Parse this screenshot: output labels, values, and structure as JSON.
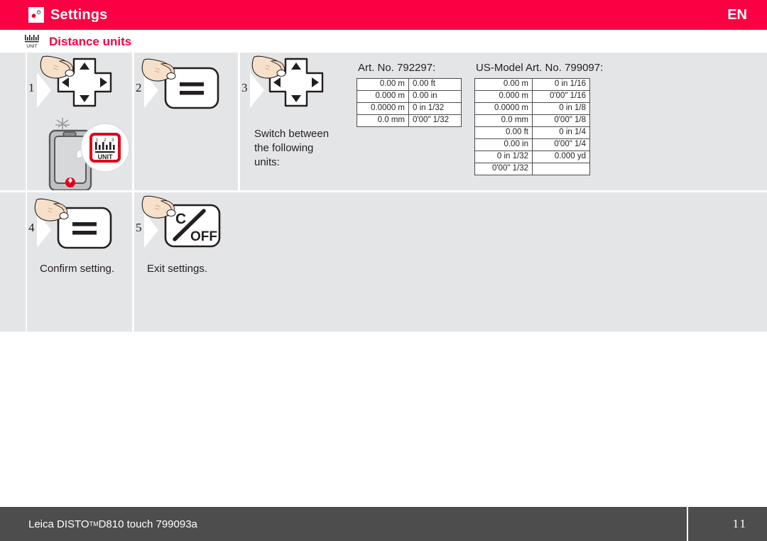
{
  "header": {
    "title": "Settings",
    "icon": "gears-icon",
    "language": "EN",
    "accent_color": "#FB0042"
  },
  "subheader": {
    "title": "Distance units",
    "icon": "unit-ruler-icon",
    "icon_label": "UNIT"
  },
  "steps": [
    {
      "number": "1",
      "art": "dpad-with-finger-and-device-unit-icon",
      "text": ""
    },
    {
      "number": "2",
      "art": "equals-key-with-finger",
      "text": ""
    },
    {
      "number": "3",
      "art": "dpad-with-finger",
      "text": "Switch between the following units:"
    },
    {
      "number": "4",
      "art": "equals-key-with-finger",
      "text": "Confirm setting."
    },
    {
      "number": "5",
      "art": "clear-off-key-with-finger",
      "text": "Exit settings."
    }
  ],
  "tables": [
    {
      "caption": "Art. No. 792297:",
      "rows": [
        [
          "0.00 m",
          "0.00 ft"
        ],
        [
          "0.000 m",
          "0.00 in"
        ],
        [
          "0.0000 m",
          "0 in 1/32"
        ],
        [
          "0.0 mm",
          "0'00\" 1/32"
        ]
      ]
    },
    {
      "caption": "US-Model Art. No. 799097:",
      "rows": [
        [
          "0.00 m",
          "0 in 1/16"
        ],
        [
          "0.000 m",
          "0'00\" 1/16"
        ],
        [
          "0.0000 m",
          "0 in 1/8"
        ],
        [
          "0.0 mm",
          "0'00\" 1/8"
        ],
        [
          "0.00 ft",
          "0 in 1/4"
        ],
        [
          "0.00 in",
          "0'00\" 1/4"
        ],
        [
          "0 in 1/32",
          "0.000 yd"
        ],
        [
          "0'00\" 1/32",
          ""
        ]
      ]
    }
  ],
  "device_keys": {
    "equals": "=",
    "clear": "C",
    "off": "OFF"
  },
  "footer": {
    "product": "Leica DISTO",
    "trademark": "TM",
    "model": " D810 touch 799093a",
    "page_number": "11",
    "background_color": "#4D4D4D"
  }
}
